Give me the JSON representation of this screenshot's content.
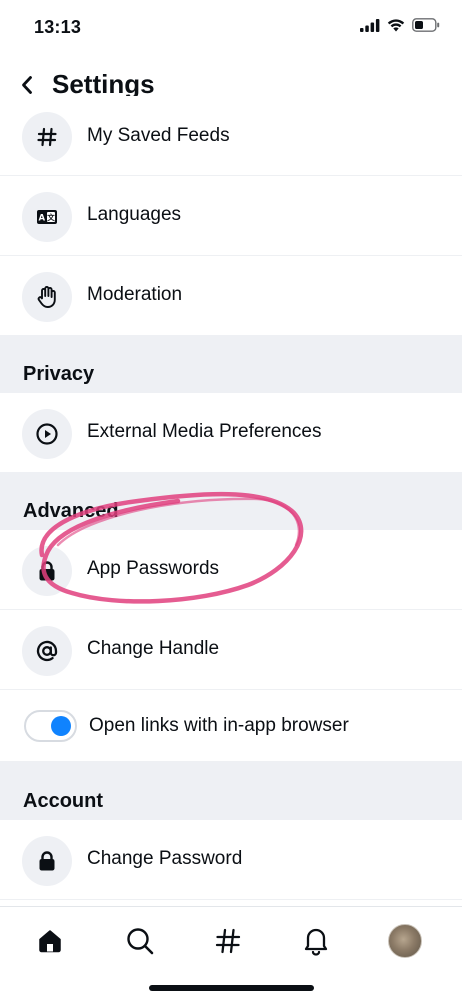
{
  "status_bar": {
    "time": "13:13",
    "icons": [
      "cellular-signal-icon",
      "wifi-icon",
      "battery-icon"
    ]
  },
  "header": {
    "back_icon": "chevron-left-icon",
    "title": "Settings"
  },
  "rows_top": [
    {
      "icon": "hash-icon",
      "label": "My Saved Feeds"
    },
    {
      "icon": "translate-icon",
      "label": "Languages"
    },
    {
      "icon": "hand-icon",
      "label": "Moderation"
    }
  ],
  "sections": {
    "privacy": {
      "title": "Privacy",
      "items": [
        {
          "icon": "play-circle-icon",
          "label": "External Media Preferences"
        }
      ]
    },
    "advanced": {
      "title": "Advanced",
      "items": [
        {
          "icon": "lock-icon",
          "label": "App Passwords"
        },
        {
          "icon": "at-sign-icon",
          "label": "Change Handle"
        }
      ],
      "toggle": {
        "label": "Open links with in-app browser",
        "on": true
      }
    },
    "account": {
      "title": "Account",
      "items": [
        {
          "icon": "lock-icon",
          "label": "Change Password"
        }
      ]
    }
  },
  "bottom_nav": [
    {
      "icon": "home-icon",
      "active": true
    },
    {
      "icon": "search-icon",
      "active": false
    },
    {
      "icon": "hash-icon",
      "active": false
    },
    {
      "icon": "bell-icon",
      "active": false
    },
    {
      "icon": "avatar",
      "active": false
    }
  ],
  "annotation": {
    "color": "#e0407e",
    "shape": "hand-drawn-circle-around-app-passwords"
  },
  "colors": {
    "accent": "#1083fe",
    "section_bg": "#eef0f4",
    "icon_bg": "#eef0f4",
    "text": "#0b0f14"
  }
}
